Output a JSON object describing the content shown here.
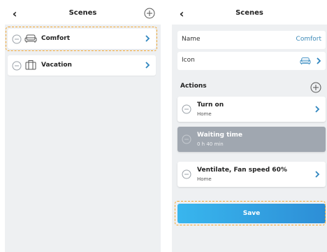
{
  "left_screen": {
    "header": {
      "back": "‹",
      "title": "Scenes"
    },
    "scenes": [
      {
        "label": "Comfort",
        "icon": "sofa-icon"
      },
      {
        "label": "Vacation",
        "icon": "suitcase-icon"
      }
    ]
  },
  "right_screen": {
    "header": {
      "back": "‹",
      "title": "Scenes"
    },
    "fields": {
      "name_label": "Name",
      "name_value": "Comfort",
      "icon_label": "Icon",
      "icon_value": "sofa-icon"
    },
    "actions_label": "Actions",
    "actions": [
      {
        "title": "Turn on",
        "subtitle": "Home",
        "state": "normal"
      },
      {
        "title": "Waiting time",
        "subtitle": "0 h 40 min",
        "state": "disabled"
      },
      {
        "title": "Ventilate, Fan speed 60%",
        "subtitle": "Home",
        "state": "normal"
      }
    ],
    "save_label": "Save"
  },
  "colors": {
    "highlight_dash": "#f2a630",
    "accent": "#2f86bf",
    "save_gradient_start": "#38b6ee",
    "save_gradient_end": "#2d8ed6",
    "disabled_row": "#a0a7b0",
    "background": "#eef0f2"
  }
}
